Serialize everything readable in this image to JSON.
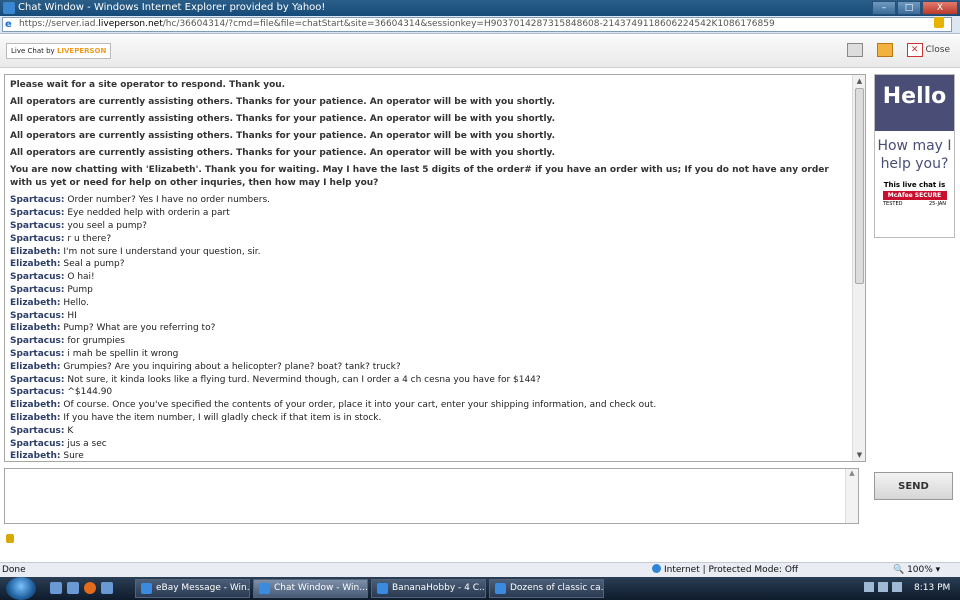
{
  "window": {
    "title": "Chat Window - Windows Internet Explorer provided by Yahoo!",
    "controls": {
      "minimize": "–",
      "maximize": "□",
      "close": "X"
    }
  },
  "address": {
    "prefix": "https://server.iad.",
    "domain": "liveperson.net",
    "rest": "/hc/36604314/?cmd=file&file=chatStart&site=36604314&sessionkey=H9037014287315848608-2143749118606224542K1086176859"
  },
  "toolbar": {
    "livechat_by": "Live Chat by",
    "liveperson": "LIVEPERSON",
    "close_label": "Close"
  },
  "transcript": {
    "system_messages": [
      "Please wait for a site operator to respond. Thank you.",
      "All operators are currently assisting others. Thanks for your patience. An operator will be with you shortly.",
      "All operators are currently assisting others. Thanks for your patience. An operator will be with you shortly.",
      "All operators are currently assisting others. Thanks for your patience. An operator will be with you shortly.",
      "All operators are currently assisting others. Thanks for your patience. An operator will be with you shortly.",
      "You are now chatting with 'Elizabeth'. Thank you for waiting. May I have the last 5 digits of the order# if you have an order with us; If you do not have any order with us yet or need for help on other inquries, then how may I help you?"
    ],
    "lines": [
      {
        "who": "Spartacus:",
        "text": "Order number? Yes I have no order numbers."
      },
      {
        "who": "Spartacus:",
        "text": "Eye nedded help with orderin a part"
      },
      {
        "who": "Spartacus:",
        "text": "you seel a pump?"
      },
      {
        "who": "Spartacus:",
        "text": "r u there?"
      },
      {
        "who": "Elizabeth:",
        "text": "I'm not sure I understand your question, sir."
      },
      {
        "who": "Elizabeth:",
        "text": "Seal a pump?"
      },
      {
        "who": "Spartacus:",
        "text": "O hai!"
      },
      {
        "who": "Spartacus:",
        "text": "Pump"
      },
      {
        "who": "Elizabeth:",
        "text": "Hello."
      },
      {
        "who": "Spartacus:",
        "text": "HI"
      },
      {
        "who": "Elizabeth:",
        "text": "Pump? What are you referring to?"
      },
      {
        "who": "Spartacus:",
        "text": "for grumpies"
      },
      {
        "who": "Spartacus:",
        "text": "i mah be spellin it wrong"
      },
      {
        "who": "Elizabeth:",
        "text": "Grumpies? Are you inquiring about a helicopter? plane? boat? tank? truck?"
      },
      {
        "who": "Spartacus:",
        "text": "Not sure, it kinda looks like a flying turd. Nevermind though, can I order a 4 ch cesna you have for $144?"
      },
      {
        "who": "Spartacus:",
        "text": "^$144.90"
      },
      {
        "who": "Elizabeth:",
        "text": "Of course. Once you've specified the contents of your order, place it into your cart, enter your shipping information, and check out."
      },
      {
        "who": "Elizabeth:",
        "text": "If you have the item number, I will gladly check if that item is in stock."
      },
      {
        "who": "Spartacus:",
        "text": "K"
      },
      {
        "who": "Spartacus:",
        "text": "jus a sec"
      },
      {
        "who": "Elizabeth:",
        "text": "Sure"
      }
    ]
  },
  "ad": {
    "hello": "Hello",
    "how_may": "How may I help you?",
    "secure_text": "This live chat is",
    "mcafee": "McAfee SECURE",
    "tested": "TESTED",
    "date": "25-JAN"
  },
  "composer": {
    "placeholder": "",
    "send_label": "SEND"
  },
  "status": {
    "done": "Done",
    "zone": "Internet | Protected Mode: Off",
    "zoom": "100%"
  },
  "taskbar": {
    "tasks": [
      {
        "label": "eBay Message - Win..."
      },
      {
        "label": "Chat Window - Win..."
      },
      {
        "label": "BananaHobby - 4 C..."
      },
      {
        "label": "Dozens of classic ca..."
      }
    ],
    "clock": "8:13 PM"
  }
}
